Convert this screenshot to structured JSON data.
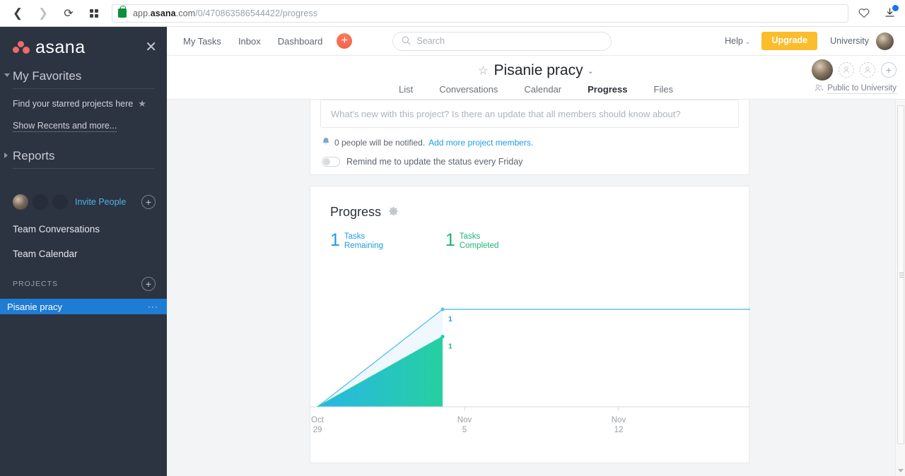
{
  "browser": {
    "back_icon": "chevron-left-icon",
    "forward_icon": "chevron-right-icon",
    "reload_icon": "reload-icon",
    "apps_icon": "grid-apps-icon",
    "lock_icon": "lock-icon",
    "url_prefix": "app.",
    "url_brand": "asana",
    "url_host_suffix": ".com",
    "url_path": "/0/470863586544422/progress",
    "bookmark_icon": "heart-icon",
    "download_icon": "download-icon"
  },
  "sidebar": {
    "logo_text": "asana",
    "close_label": "✕",
    "favorites": {
      "title": "My Favorites",
      "starred_hint": "Find your starred projects here",
      "star_glyph": "★",
      "recents_label": "Show Recents and more..."
    },
    "reports": {
      "title": "Reports"
    },
    "invite": {
      "label": "Invite People",
      "plus_label": "+"
    },
    "items": [
      {
        "label": "Team Conversations"
      },
      {
        "label": "Team Calendar"
      }
    ],
    "projects": {
      "header": "PROJECTS",
      "add_label": "+",
      "selected": "Pisanie pracy",
      "row_menu": "···"
    }
  },
  "topnav": {
    "links": [
      {
        "label": "My Tasks"
      },
      {
        "label": "Inbox"
      },
      {
        "label": "Dashboard"
      }
    ],
    "add_label": "+",
    "search": {
      "placeholder": "Search",
      "icon": "search-icon",
      "value": ""
    },
    "help_label": "Help",
    "help_caret": "⌄",
    "upgrade_label": "Upgrade",
    "university_label": "University"
  },
  "project": {
    "star_glyph": "☆",
    "title": "Pisanie pracy",
    "caret": "⌄",
    "tabs": [
      {
        "label": "List",
        "active": false
      },
      {
        "label": "Conversations",
        "active": false
      },
      {
        "label": "Calendar",
        "active": false
      },
      {
        "label": "Progress",
        "active": true
      },
      {
        "label": "Files",
        "active": false
      }
    ],
    "members": {
      "ghost_glyph": "○",
      "plus_label": "+",
      "privacy_label": "Public to University",
      "privacy_icon": "people-icon"
    }
  },
  "status_card": {
    "input_placeholder": "What's new with this project? Is there an update that all members should know about?",
    "input_value": "",
    "bell_icon": "bell-icon",
    "notify_text": "0 people will be notified.",
    "notify_link": "Add more project members.",
    "reminder_label": "Remind me to update the status every Friday",
    "reminder_on": false
  },
  "progress_card": {
    "title": "Progress",
    "settings_icon": "gear-icon",
    "stats": [
      {
        "number": "1",
        "line1": "Tasks",
        "line2": "Remaining",
        "color": "#1f9de0"
      },
      {
        "number": "1",
        "line1": "Tasks",
        "line2": "Completed",
        "color": "#21b573"
      }
    ]
  },
  "chart_data": {
    "type": "area",
    "title": "Progress",
    "xlabel": "",
    "ylabel": "",
    "x": [
      "Oct 29",
      "Nov 5",
      "Nov 12"
    ],
    "tick_labels": [
      {
        "line1": "Oct",
        "line2": "29"
      },
      {
        "line1": "Nov",
        "line2": "5"
      },
      {
        "line1": "Nov",
        "line2": "12"
      }
    ],
    "xlim": [
      "Oct 29",
      "Nov 15"
    ],
    "ylim": [
      0,
      1
    ],
    "grid": false,
    "legend": "none",
    "point_labels": [
      "1",
      "1"
    ],
    "series": [
      {
        "name": "Tasks Remaining",
        "color": "#5ec2ea",
        "fill": "#eef8fd",
        "values": [
          0,
          1,
          1
        ],
        "label_value": "1",
        "label_color": "#1f9de0"
      },
      {
        "name": "Tasks Completed",
        "color": "#21ceaa",
        "fill_start": "#29b6e8",
        "fill_end": "#25d0a0",
        "values": [
          0,
          1,
          null
        ],
        "label_value": "1",
        "label_color": "#21b573"
      }
    ]
  },
  "scrollbar": {
    "down_arrow": "chevron-down-icon"
  }
}
